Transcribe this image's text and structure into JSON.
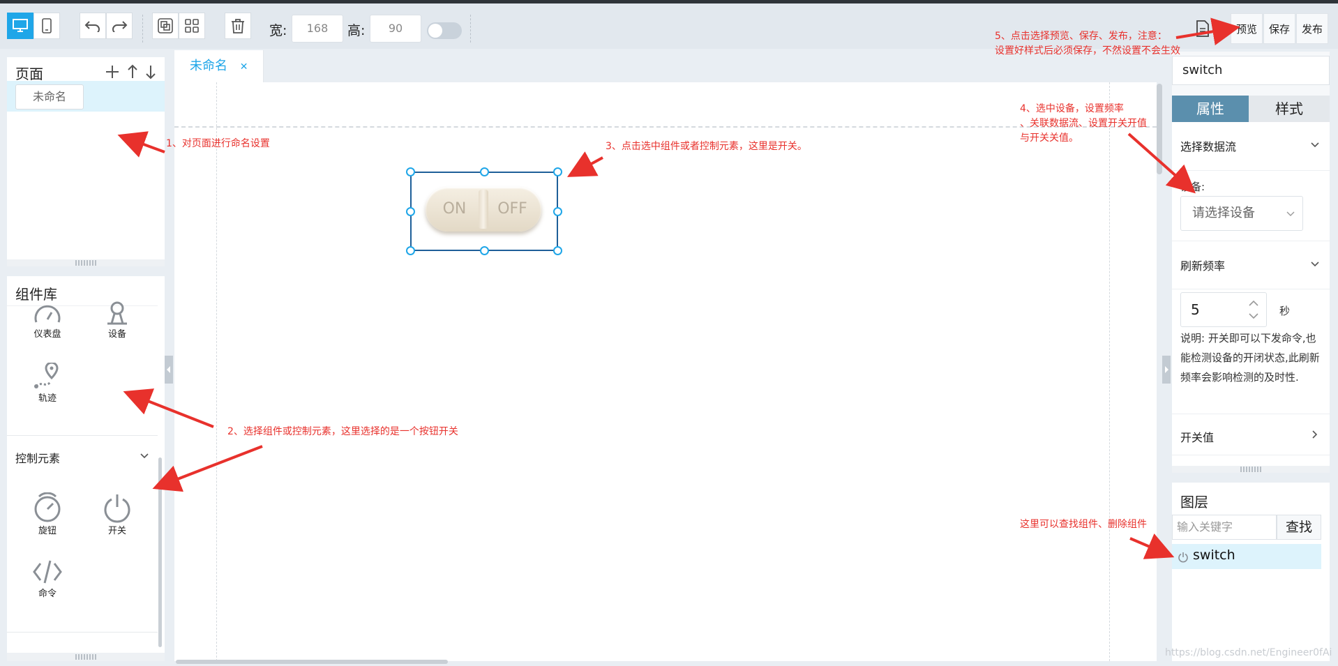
{
  "toolbar": {
    "width_label": "宽:",
    "width_value": "168",
    "height_label": "高:",
    "height_value": "90",
    "preview_label": "预览",
    "save_label": "保存",
    "publish_label": "发布"
  },
  "pages_panel": {
    "title": "页面",
    "items": [
      "未命名"
    ]
  },
  "component_library": {
    "title": "组件库",
    "items_top": [
      "仪表盘",
      "设备",
      "轨迹"
    ],
    "control_section_title": "控制元素",
    "control_items": [
      "旋钮",
      "开关",
      "命令"
    ]
  },
  "canvas": {
    "tab_label": "未命名",
    "switch_on_text": "ON",
    "switch_off_text": "OFF"
  },
  "properties_panel": {
    "component_name": "switch",
    "tabs": [
      "属性",
      "样式"
    ],
    "active_tab": "属性",
    "data_stream_title": "选择数据流",
    "device_label": "设备:",
    "device_placeholder": "请选择设备",
    "refresh_title": "刷新频率",
    "refresh_value": "5",
    "refresh_unit": "秒",
    "note": "说明: 开关即可以下发命令,也能检测设备的开闭状态,此刷新频率会影响检测的及时性.",
    "switch_value_title": "开关值"
  },
  "layers_panel": {
    "title": "图层",
    "search_placeholder": "输入关键字",
    "search_button": "查找",
    "items": [
      "switch"
    ]
  },
  "annotations": {
    "a1": "1、对页面进行命名设置",
    "a2": "2、选择组件或控制元素，这里选择的是一个按钮开关",
    "a3": "3、点击选中组件或者控制元素，这里是开关。",
    "a4_l1": "4、选中设备，设置频率",
    "a4_l2": "、关联数据流、设置开关开值",
    "a4_l3": "与开关关值。",
    "a5_l1": "5、点击选择预览、保存、发布，注意：",
    "a5_l2": "设置好样式后必须保存，不然设置不会生效",
    "a6": "这里可以查找组件、删除组件",
    "watermark": "https://blog.csdn.net/Engineer0fAi"
  },
  "colors": {
    "accent": "#1fa6e8",
    "annotation": "#e8312c",
    "active_tab_bg": "#5b8fad"
  }
}
